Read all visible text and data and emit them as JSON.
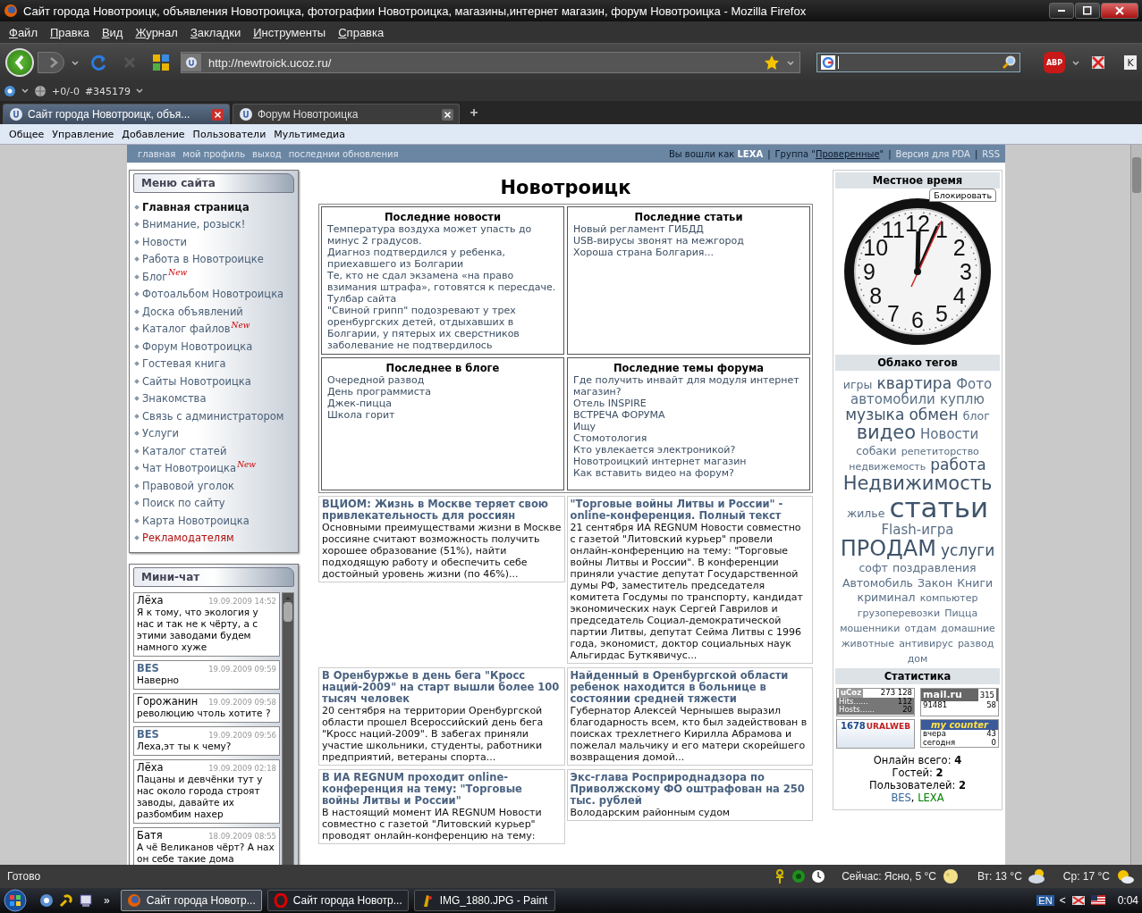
{
  "window": {
    "title": "Сайт города Новотроицк, объявления Новотроицка, фотографии Новотроицка, магазины,интернет магазин, форум Новотроицка - Mozilla Firefox"
  },
  "menu": [
    "Файл",
    "Правка",
    "Вид",
    "Журнал",
    "Закладки",
    "Инструменты",
    "Справка"
  ],
  "toolbar": {
    "address": "http://newtroick.ucoz.ru/",
    "adblock": "ABP",
    "k_button": "K"
  },
  "addon_bar": {
    "counter": "+0/-0",
    "number": "#345179"
  },
  "tabs": [
    {
      "label": "Сайт города Новотроицк, объя...",
      "selected": true
    },
    {
      "label": "Форум Новотроицка",
      "selected": false
    }
  ],
  "admin_bar": [
    "Общее",
    "Управление",
    "Добавление",
    "Пользователи",
    "Мультимедиа"
  ],
  "top_links": [
    "главная",
    "мой профиль",
    "выход",
    "последнии обновления"
  ],
  "user_bar": [
    {
      "kind": "text",
      "text": "Вы вошли как **LEXA**"
    },
    {
      "kind": "sep",
      "text": "|"
    },
    {
      "kind": "group",
      "text": "Группа \"",
      "link": "Проверенные",
      "suffix": "\""
    },
    {
      "kind": "sep",
      "text": "|"
    },
    {
      "kind": "link",
      "text": "Версия для PDA"
    },
    {
      "kind": "sep",
      "text": "|"
    },
    {
      "kind": "link",
      "text": "RSS"
    }
  ],
  "site_menu": {
    "title": "Меню сайта",
    "items": [
      {
        "label": "Главная страница",
        "selected": true,
        "kind": "link"
      },
      {
        "label": "Внимание, розыск!",
        "selected": false,
        "kind": "link"
      },
      {
        "label": "Новости",
        "selected": false,
        "kind": "link"
      },
      {
        "label": "Работа в Новотроицке",
        "selected": false,
        "kind": "link"
      },
      {
        "label": "Блог",
        "selected": false,
        "kind": "link",
        "badge": "New"
      },
      {
        "label": "Фотоальбом Новотроицка",
        "selected": false,
        "kind": "link"
      },
      {
        "label": "Доска объявлений",
        "selected": false,
        "kind": "link"
      },
      {
        "label": "Каталог файлов",
        "selected": false,
        "kind": "link",
        "badge": "New"
      },
      {
        "label": "Форум Новотроицка",
        "selected": false,
        "kind": "link"
      },
      {
        "label": "Гостевая книга",
        "selected": false,
        "kind": "link"
      },
      {
        "label": "Сайты Новотроицка",
        "selected": false,
        "kind": "link"
      },
      {
        "label": "Знакомства",
        "selected": false,
        "kind": "link"
      },
      {
        "label": "Связь с администратором",
        "selected": false,
        "kind": "link"
      },
      {
        "label": "Услуги",
        "selected": false,
        "kind": "link"
      },
      {
        "label": "Каталог статей",
        "selected": false,
        "kind": "link"
      },
      {
        "label": "Чат Новотроицка",
        "selected": false,
        "kind": "link",
        "badge": "New"
      },
      {
        "label": "Правовой уголок",
        "selected": false,
        "kind": "link"
      },
      {
        "label": "Поиск по сайту",
        "selected": false,
        "kind": "link"
      },
      {
        "label": "Карта Новотроицка",
        "selected": false,
        "kind": "link"
      },
      {
        "label": "Рекламодателям",
        "selected": false,
        "kind": "promo"
      }
    ]
  },
  "chat": {
    "title": "Мини-чат",
    "messages": [
      {
        "author": "Лёха",
        "registered": false,
        "date": "19.09.2009 14:52",
        "text": "Я к тому, что экология у нас и так не к чёрту, а с этими заводами будем намного хуже"
      },
      {
        "author": "BES",
        "registered": true,
        "date": "19.09.2009 09:59",
        "text": "Наверно"
      },
      {
        "author": "Горожанин",
        "registered": false,
        "date": "19.09.2009 09:58",
        "text": "революцию чтоль хотите ?"
      },
      {
        "author": "BES",
        "registered": true,
        "date": "19.09.2009 09:56",
        "text": "Леха,эт ты к чему?"
      },
      {
        "author": "Лёха",
        "registered": false,
        "date": "19.09.2009 02:18",
        "text": "Пацаны и девчёнки тут у нас около города строят заводы, давайте их разбомбим нахер"
      },
      {
        "author": "Батя",
        "registered": false,
        "date": "18.09.2009 08:55",
        "text": "А чё Великанов чёрт? А нах он себе такие дома"
      }
    ]
  },
  "heading": "Новотроицк",
  "blocks": [
    {
      "title": "Последние новости",
      "links": [
        "Температура воздуха может упасть до минус 2 градусов.",
        "Диагноз подтвердился у ребенка, приехавшего из Болгарии",
        "Те, кто не сдал экзамена «на право взимания штрафа», готовятся к пересдаче.",
        "Тулбар сайта",
        "\"Свиной грипп\" подозревают у трех оренбургских детей, отдыхавших в Болгарии, у пятерых их сверстников заболевание не подтвердилось"
      ]
    },
    {
      "title": "Последние статьи",
      "links": [
        "Новый регламент ГИБДД",
        "USB-вирусы звонят на межгород",
        "Хороша страна Болгария..."
      ]
    },
    {
      "title": "Последнее в блоге",
      "links": [
        "Очередной развод",
        "День программиста",
        "Джек-пицца",
        "Школа горит"
      ]
    },
    {
      "title": "Последние темы форума",
      "links": [
        "Где получить инвайт для модуля интернет магазин?",
        "Отель INSPIRE",
        "ВСТРЕЧА ФОРУМА",
        "Ищу",
        "Стомотология",
        "Кто увлекается электроникой?",
        "Новотроицкий интернет магазин",
        "Как вставить видео на форум?"
      ]
    }
  ],
  "news": [
    {
      "title": "ВЦИОМ: Жизнь в Москве теряет свою привлекательность для россиян",
      "text": "Основными преимуществами жизни в Москве россияне считают возможность получить хорошее образование (51%), найти подходящую работу и обеспечить себе достойный уровень жизни (по 46%)..."
    },
    {
      "title": "\"Торговые войны Литвы и России\" - online-конференция. Полный текст",
      "text": "21 сентября ИА REGNUM Новости совместно с газетой \"Литовский курьер\" провели онлайн-конференцию на тему: \"Торговые войны Литвы и России\". В конференции приняли участие депутат Государственной думы РФ, заместитель председателя комитета Госдумы по транспорту, кандидат экономических наук Сергей Гаврилов и председатель Социал-демократической партии Литвы, депутат Сейма Литвы с 1996 года, экономист, доктор социальных наук Альгирдас Буткявичус..."
    },
    {
      "title": "В Оренбуржье в день бега \"Кросс наций-2009\" на старт вышли более 100 тысяч человек",
      "text": "20 сентября на территории Оренбургской области прошел Всероссийский день бега \"Кросс наций-2009\". В забегах приняли участие школьники, студенты, работники предприятий, ветераны спорта..."
    },
    {
      "title": "Найденный в Оренбургской области ребенок находится в больнице в состоянии средней тяжести",
      "text": "Губернатор Алексей Чернышев выразил благодарность всем, кто был задействован в поисках трехлетнего Кирилла Абрамова и пожелал мальчику и его матери скорейшего возвращения домой..."
    },
    {
      "title": "В ИА REGNUM проходит online-конференция на тему: \"Торговые войны Литвы и России\"",
      "text": "В настоящий момент ИА REGNUM Новости совместно с газетой \"Литовский курьер\" проводят онлайн-конференцию на тему:"
    },
    {
      "title": "Экс-глава Росприроднадзора по Приволжскому ФО оштрафован на 250 тыс. рублей",
      "text": "Володарским районным судом"
    }
  ],
  "clock": {
    "title": "Местное время",
    "button": "Блокировать",
    "numerals": [
      "11",
      "12",
      "1",
      "10",
      "2",
      "9",
      "3",
      "8",
      "4",
      "7",
      "6",
      "5"
    ]
  },
  "tags": {
    "title": "Облако тегов",
    "items": [
      {
        "label": "игры",
        "kind": "small"
      },
      {
        "label": "квартира",
        "kind": "large"
      },
      {
        "label": "Фото",
        "kind": "medium"
      },
      {
        "label": "автомобили",
        "kind": "medium"
      },
      {
        "label": "куплю",
        "kind": "medium"
      },
      {
        "label": "музыка",
        "kind": "large"
      },
      {
        "label": "обмен",
        "kind": "large"
      },
      {
        "label": "блог",
        "kind": "small"
      },
      {
        "label": "видео",
        "kind": "big"
      },
      {
        "label": "Новости",
        "kind": "medium"
      },
      {
        "label": "собаки",
        "kind": "small"
      },
      {
        "label": "репетиторство",
        "kind": "tiny"
      },
      {
        "label": "недвижемость",
        "kind": "tiny"
      },
      {
        "label": "работа",
        "kind": "large"
      },
      {
        "label": "Недвижимость",
        "kind": "big"
      },
      {
        "label": "жилье",
        "kind": "small"
      },
      {
        "label": "статьи",
        "kind": "giant"
      },
      {
        "label": "Flash-игра",
        "kind": "medium"
      },
      {
        "label": "ПРОДАМ",
        "kind": "huge"
      },
      {
        "label": "услуги",
        "kind": "large"
      },
      {
        "label": "софт",
        "kind": "small"
      },
      {
        "label": "поздравления",
        "kind": "small"
      },
      {
        "label": "Автомобиль",
        "kind": "small"
      },
      {
        "label": "Закон",
        "kind": "small"
      },
      {
        "label": "Книги",
        "kind": "small"
      },
      {
        "label": "криминал",
        "kind": "small"
      },
      {
        "label": "компьютер",
        "kind": "tiny"
      },
      {
        "label": "грузоперевозки",
        "kind": "tiny"
      },
      {
        "label": "Пицца",
        "kind": "tiny"
      },
      {
        "label": "мошенники",
        "kind": "tiny"
      },
      {
        "label": "отдам",
        "kind": "tiny"
      },
      {
        "label": "домашние",
        "kind": "tiny"
      },
      {
        "label": "животные",
        "kind": "tiny"
      },
      {
        "label": "антивирус",
        "kind": "tiny"
      },
      {
        "label": "развод",
        "kind": "tiny"
      },
      {
        "label": "дом",
        "kind": "tiny"
      }
    ]
  },
  "stats": {
    "title": "Статистика",
    "counters": [
      {
        "kind": "ucoz",
        "texts": [
          "uCoz",
          "273 128",
          "Hits......",
          "112",
          "Hosts......",
          "20"
        ]
      },
      {
        "kind": "mail",
        "texts": [
          "mail.ru",
          "315",
          "91481",
          "58"
        ]
      },
      {
        "kind": "uralweb",
        "texts": [
          "1678",
          "URALWEB"
        ]
      },
      {
        "kind": "mycounter",
        "texts": [
          "my counter",
          "вчера",
          "43",
          "сегодня",
          "0"
        ]
      }
    ],
    "online": [
      "Онлайн всего: **4**",
      "Гостей: **2**",
      "Пользователей: **2**"
    ],
    "users": [
      {
        "name": "BES",
        "color": "#336699"
      },
      {
        "name": "LEXA",
        "color": "#008000"
      }
    ],
    "users_separator": ", "
  },
  "status_bar": {
    "text": "Готово",
    "weather": [
      {
        "label": "Сейчас: Ясно, 5 °C",
        "kind": "moon"
      },
      {
        "label": "Вт: 13 °C",
        "kind": "cloudy"
      },
      {
        "label": "Ср: 17 °C",
        "kind": "sunny"
      }
    ]
  },
  "taskbar": {
    "more": "»",
    "tasks": [
      {
        "label": "Сайт города Новотр...",
        "kind": "firefox",
        "selected": true
      },
      {
        "label": "Сайт города Новотр...",
        "kind": "opera",
        "selected": false
      },
      {
        "label": "IMG_1880.JPG - Paint",
        "kind": "paint",
        "selected": false
      }
    ],
    "lang": "EN",
    "tray_toggle": "<",
    "time": "0:04"
  }
}
